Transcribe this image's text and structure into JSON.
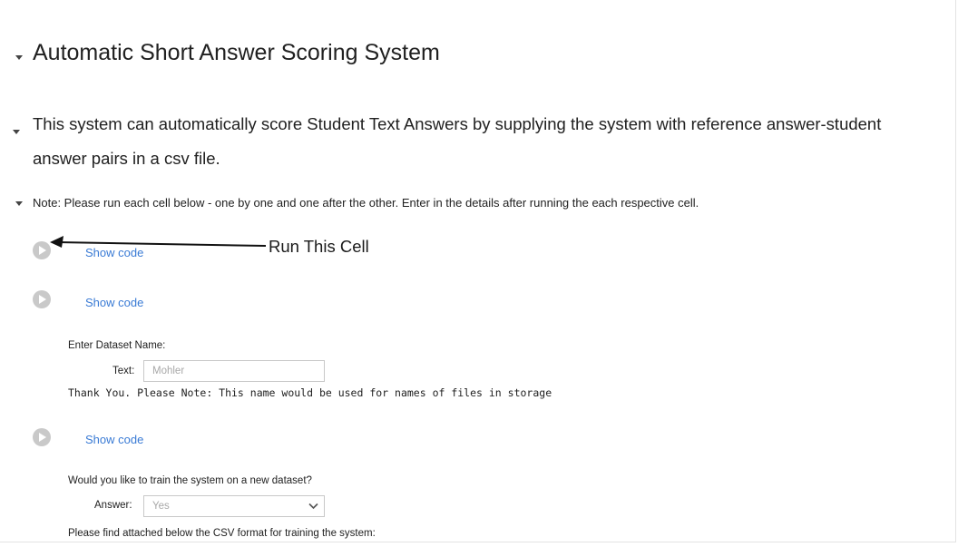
{
  "heading": "Automatic Short Answer Scoring System",
  "intro": "This system can automatically score Student Text Answers by supplying the system with reference answer-student answer pairs in a csv file.",
  "note": "Note: Please run each cell below - one by one and one after the other. Enter in the details after running the each respective cell.",
  "cells": [
    {
      "show_code": "Show code",
      "annotation": "Run This Cell"
    },
    {
      "show_code": "Show code"
    },
    {
      "show_code": "Show code"
    }
  ],
  "dataset_form": {
    "prompt": "Enter Dataset Name:",
    "field_label": "Text:",
    "placeholder": "Mohler",
    "value": "",
    "output": "Thank You. Please Note: This name would be used for names of files in storage"
  },
  "train_form": {
    "prompt": "Would you like to train the system on a new dataset?",
    "field_label": "Answer:",
    "selected": "Yes",
    "footer": "Please find attached below the CSV format for training the system:"
  },
  "icons": {
    "run": "play-circle-icon",
    "collapse": "caret-down-icon",
    "dropdown": "chevron-down-icon"
  },
  "colors": {
    "link": "#3a7bd5",
    "run_button": "#c9c9c9"
  }
}
